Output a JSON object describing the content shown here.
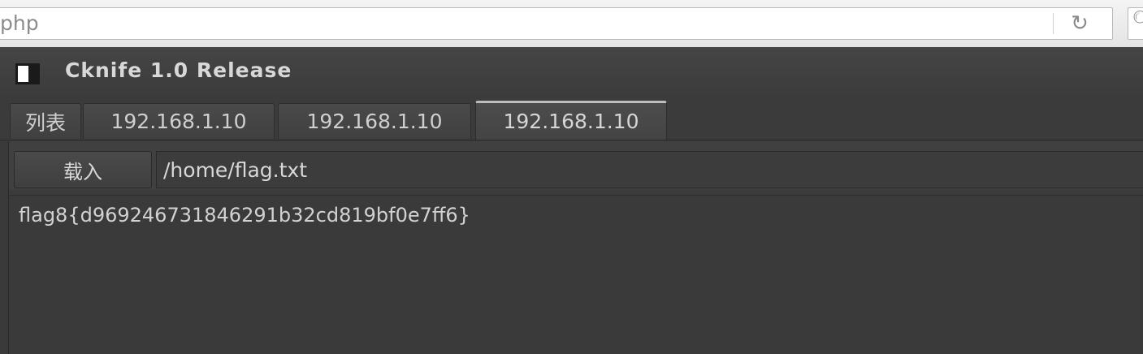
{
  "browser": {
    "url_text": "php",
    "reload_icon": "reload-icon",
    "search_icon": "search-icon"
  },
  "window": {
    "title": "Cknife 1.0 Release",
    "icon": "window-icon"
  },
  "tabs": [
    {
      "label": "列表",
      "active": false
    },
    {
      "label": "192.168.1.10",
      "active": false
    },
    {
      "label": "192.168.1.10",
      "active": false
    },
    {
      "label": "192.168.1.10",
      "active": true
    }
  ],
  "toolbar": {
    "load_label": "载入",
    "path_value": "/home/flag.txt"
  },
  "file_content": "flag8{d969246731846291b32cd819bf0e7ff6}",
  "colors": {
    "window_bg": "#3a3a3a",
    "text": "#d2d2d2",
    "active_tab_indicator": "#bdbdbd"
  }
}
